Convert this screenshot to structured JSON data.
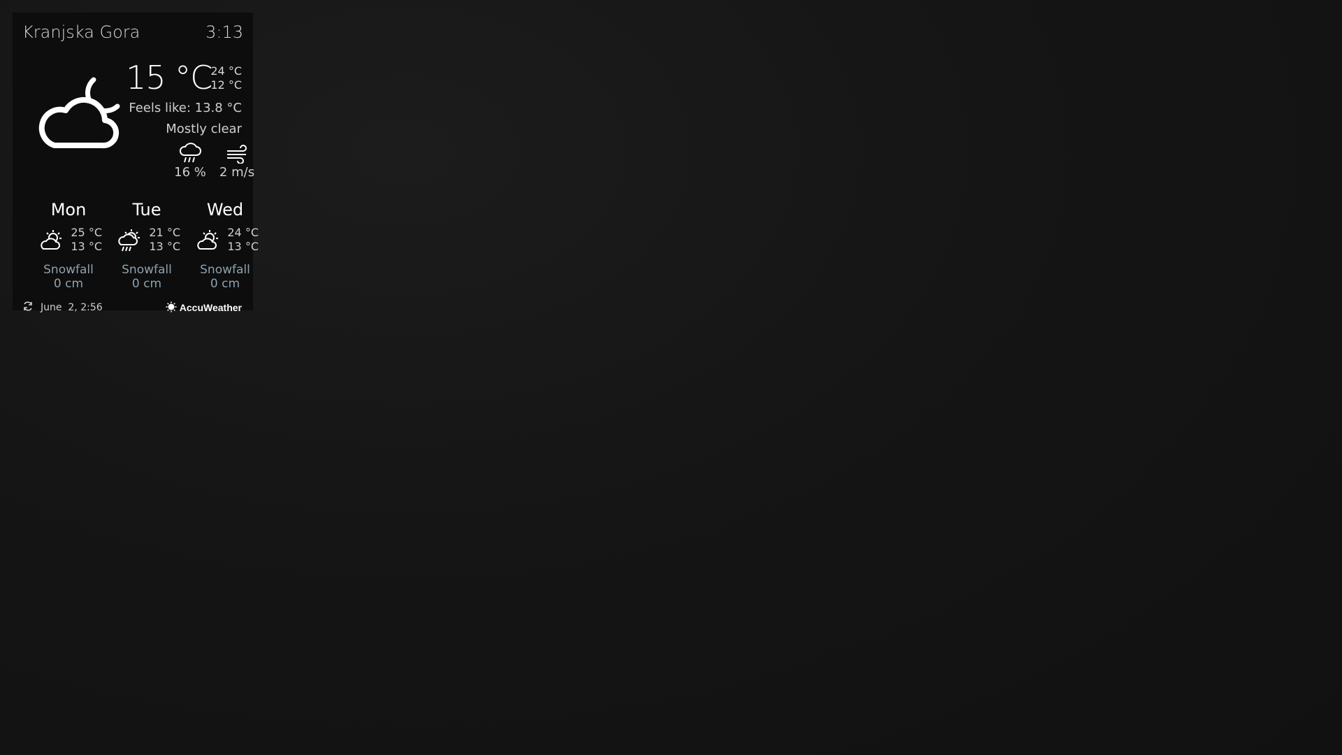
{
  "widget": {
    "location": "Kranjska Gora",
    "time": "3:13",
    "current": {
      "temperature": "15 °C",
      "high": "24 °C",
      "low": "12 °C",
      "feels_like": "Feels like: 13.8 °C",
      "condition": "Mostly clear",
      "icon": "cloud-moon-icon",
      "precipitation": "16 %",
      "wind": "2 m/s"
    },
    "forecast": [
      {
        "day": "Mon",
        "icon": "partly-sunny-icon",
        "high": "25 °C",
        "low": "13 °C",
        "snow_label": "Snowfall",
        "snow_value": "0 cm"
      },
      {
        "day": "Tue",
        "icon": "sun-rain-icon",
        "high": "21 °C",
        "low": "13 °C",
        "snow_label": "Snowfall",
        "snow_value": "0 cm"
      },
      {
        "day": "Wed",
        "icon": "partly-sunny-icon",
        "high": "24 °C",
        "low": "13 °C",
        "snow_label": "Snowfall",
        "snow_value": "0 cm"
      }
    ],
    "footer": {
      "updated": "June  2, 2:56",
      "provider": "AccuWeather"
    }
  }
}
